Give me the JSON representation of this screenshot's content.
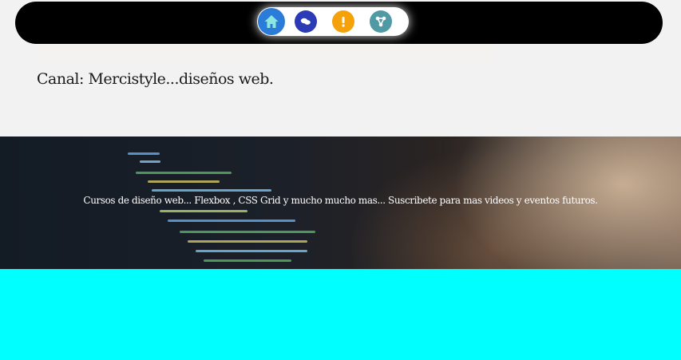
{
  "nav": {
    "items": [
      {
        "name": "home",
        "icon": "home-icon",
        "color": "#2b7bd8"
      },
      {
        "name": "chat",
        "icon": "chat-bubbles-icon",
        "color": "#2a3bb5"
      },
      {
        "name": "alert",
        "icon": "exclamation-icon",
        "color": "#f5a10a"
      },
      {
        "name": "share",
        "icon": "share-nodes-icon",
        "color": "#4f9aa5"
      }
    ]
  },
  "header": {
    "title": "Canal: Mercistyle...diseños web."
  },
  "hero": {
    "text": "Cursos de diseño web... Flexbox , CSS Grid y mucho mucho mas... Suscribete para mas videos y eventos futuros."
  },
  "colors": {
    "topbar": "#000000",
    "page_bg": "#f2f2f2",
    "band": "#00ffff"
  }
}
